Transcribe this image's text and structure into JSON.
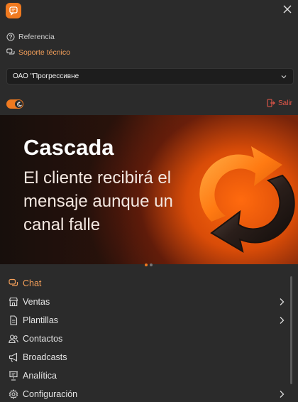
{
  "header": {
    "logo_icon": "chat-bubble-logo-icon",
    "close_icon": "close-icon",
    "accent": "#f07a20"
  },
  "links": {
    "reference": {
      "label": "Referencia",
      "icon": "question-circle-icon"
    },
    "support": {
      "label": "Soporte técnico",
      "icon": "chat-bubbles-icon",
      "color": "#f5a05a"
    }
  },
  "company_select": {
    "value": "ОАО \"Прогрессивне",
    "icon": "chevron-down-icon"
  },
  "theme_toggle": {
    "state": "on",
    "icon": "moon-icon"
  },
  "logout": {
    "label": "Salir",
    "icon": "logout-icon",
    "color": "#e8584a"
  },
  "banner": {
    "title": "Cascada",
    "line1": "El cliente recibirá el",
    "line2": "mensaje aunque un",
    "line3": "canal falle",
    "slides": 2,
    "active_slide": 1
  },
  "menu": [
    {
      "label": "Chat",
      "icon": "chat-icon",
      "active": true,
      "has_submenu": false
    },
    {
      "label": "Ventas",
      "icon": "store-icon",
      "active": false,
      "has_submenu": true
    },
    {
      "label": "Plantillas",
      "icon": "document-icon",
      "active": false,
      "has_submenu": true
    },
    {
      "label": "Contactos",
      "icon": "users-icon",
      "active": false,
      "has_submenu": false
    },
    {
      "label": "Broadcasts",
      "icon": "megaphone-icon",
      "active": false,
      "has_submenu": false
    },
    {
      "label": "Analítica",
      "icon": "presentation-icon",
      "active": false,
      "has_submenu": false
    },
    {
      "label": "Configuración",
      "icon": "gear-icon",
      "active": false,
      "has_submenu": true
    }
  ]
}
